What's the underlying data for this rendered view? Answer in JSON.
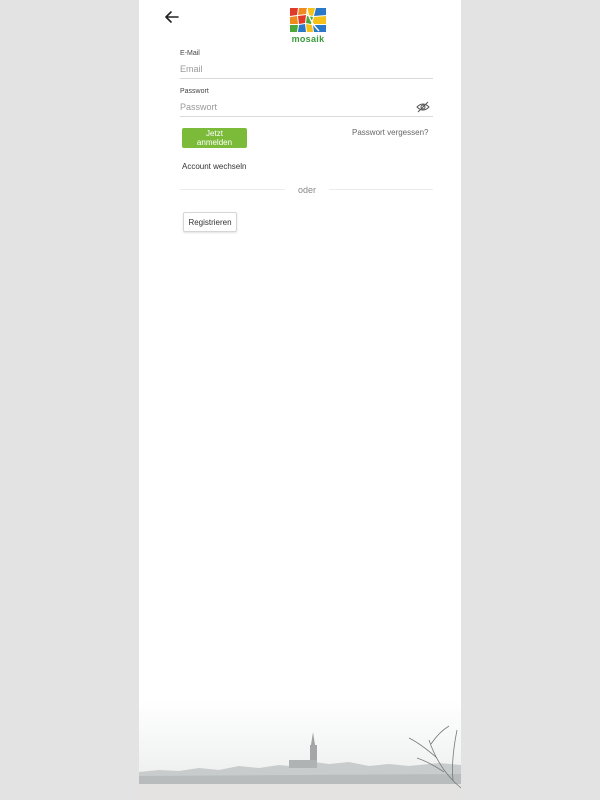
{
  "header": {
    "back_icon": "arrow-left-icon",
    "logo_text": "mosaik"
  },
  "form": {
    "email_label": "E-Mail",
    "email_placeholder": "Email",
    "email_value": "",
    "password_label": "Passwort",
    "password_placeholder": "Passwort",
    "password_value": "",
    "password_toggle_icon": "eye-slash-icon",
    "login_button": "Jetzt anmelden",
    "forgot_password": "Passwort vergessen?",
    "switch_account": "Account wechseln",
    "divider_text": "oder",
    "register_button": "Registrieren"
  },
  "colors": {
    "page_background": "#e3e3e3",
    "panel_background": "#ffffff",
    "primary_button": "#7cbb39",
    "logo_text": "#3b9c3b"
  }
}
